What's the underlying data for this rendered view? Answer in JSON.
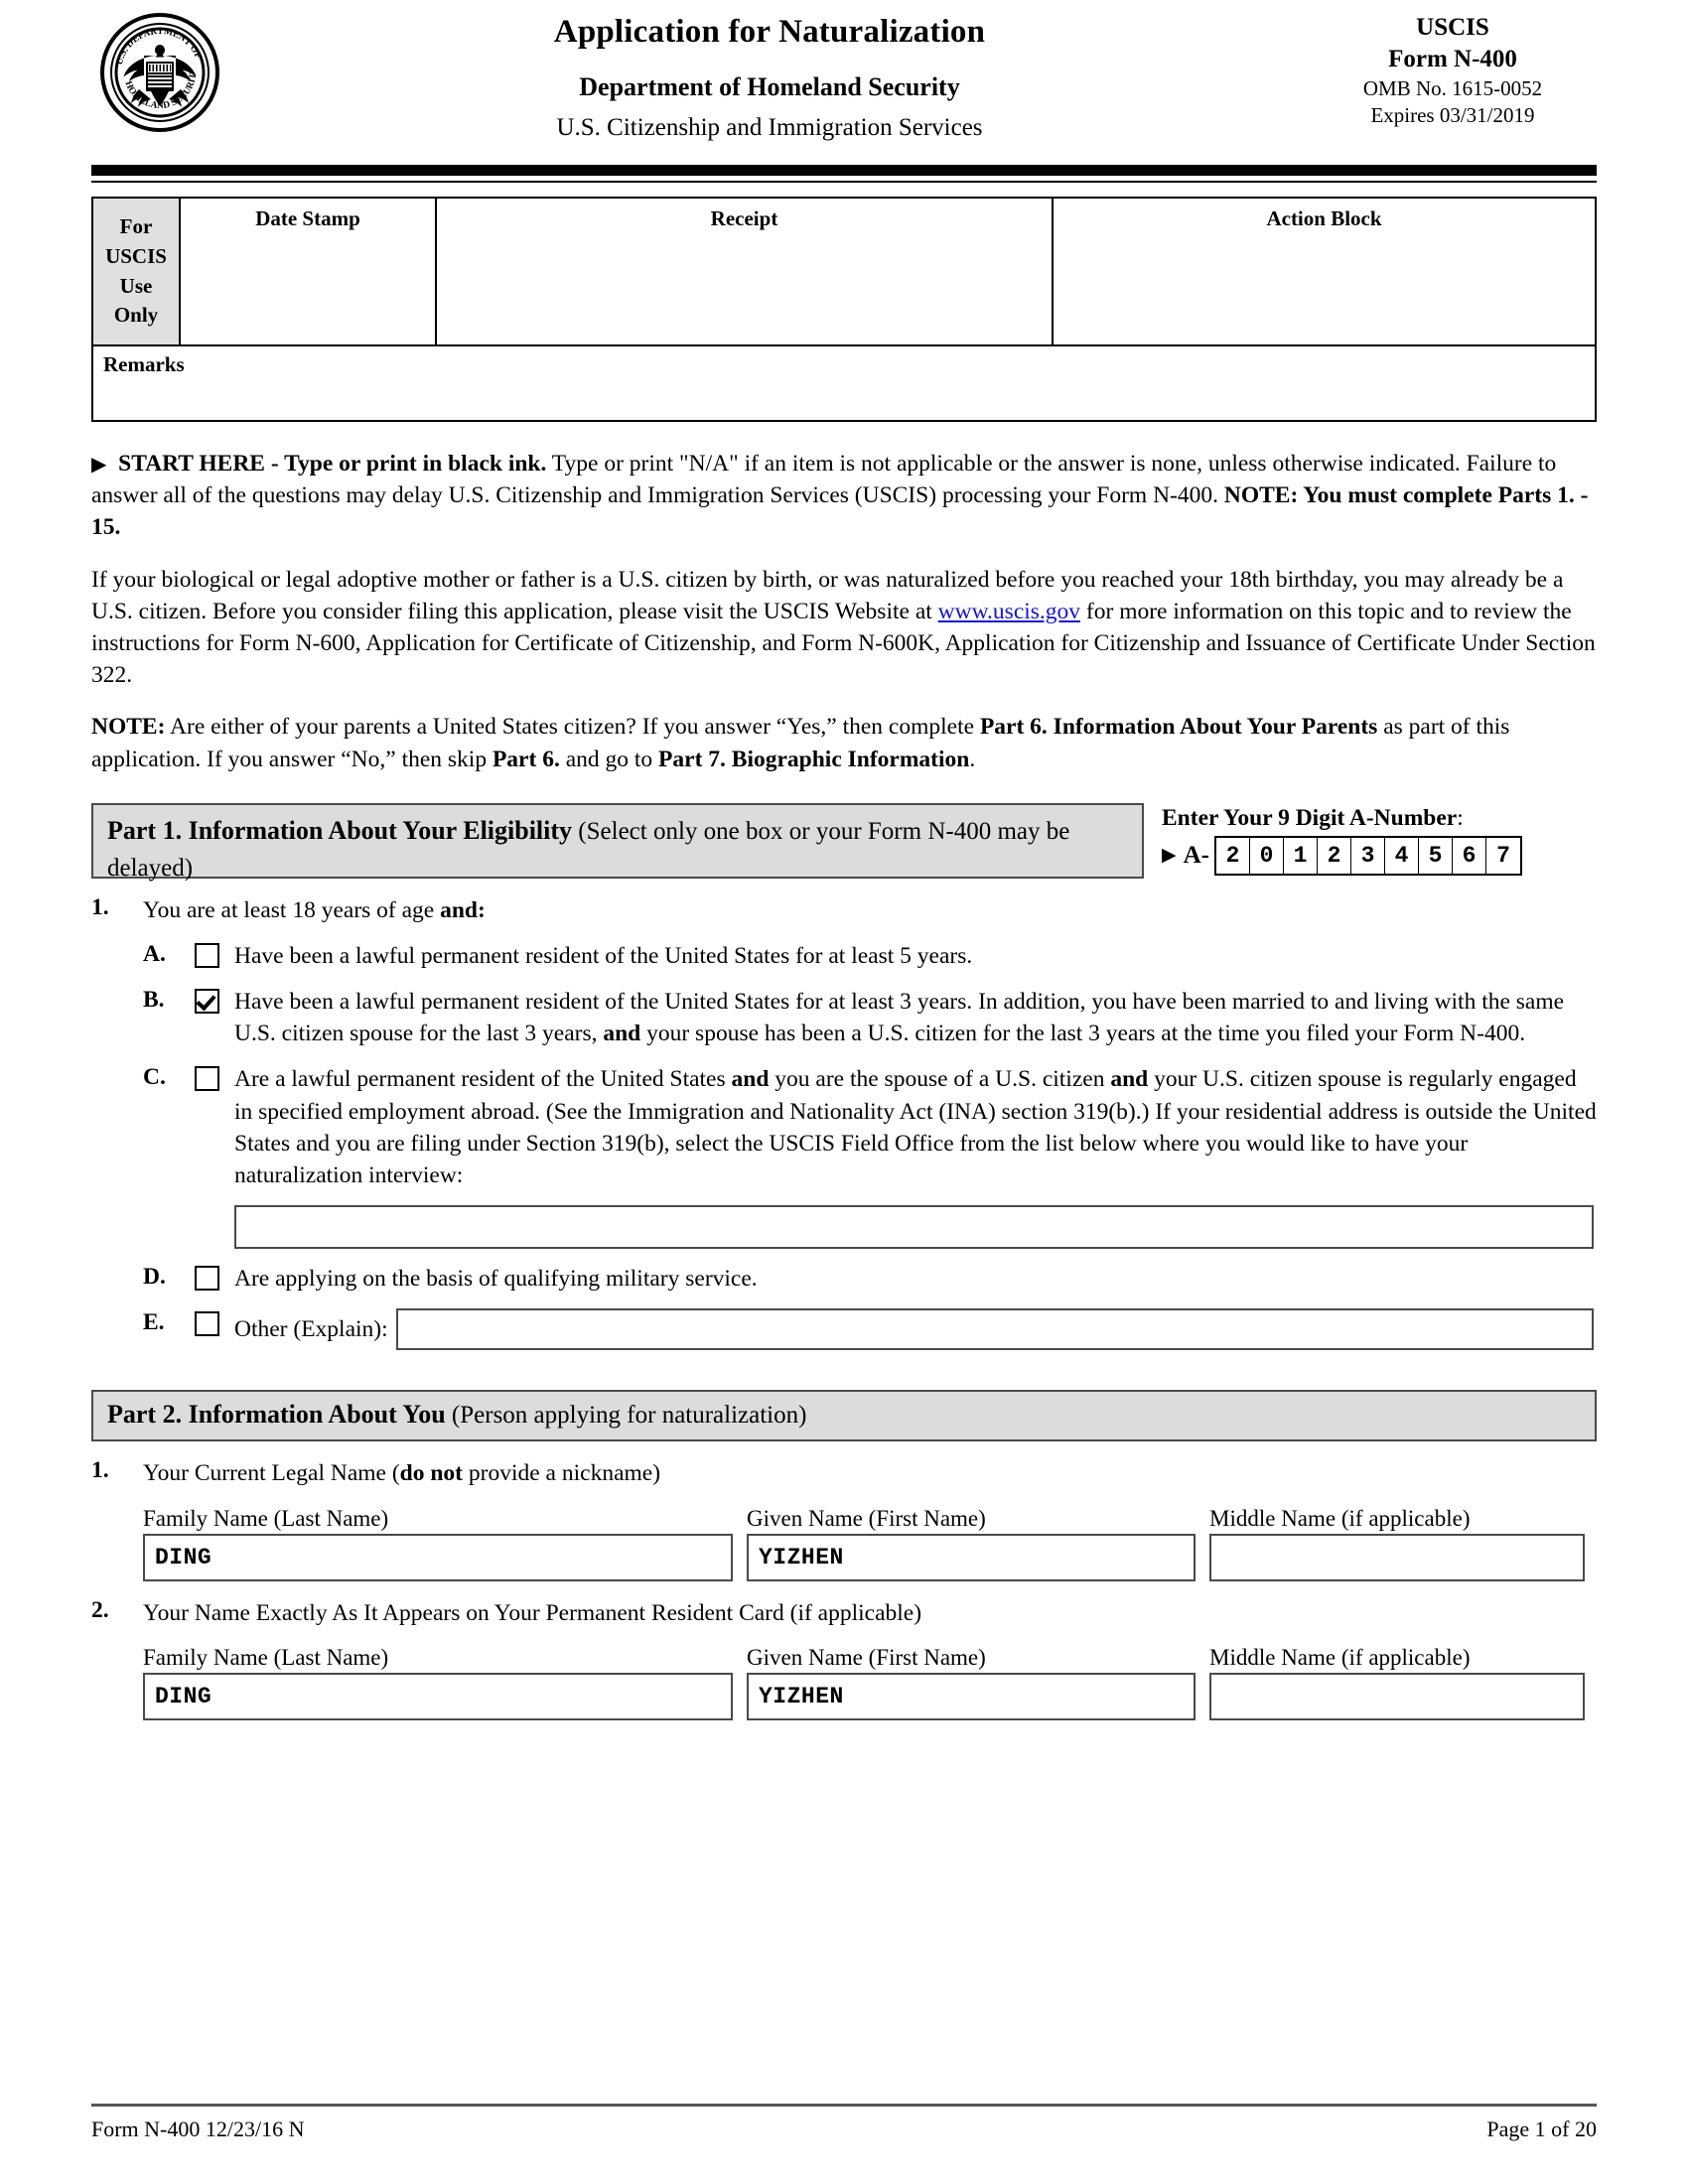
{
  "header": {
    "seal_alt": "dhs-seal",
    "title": "Application for Naturalization",
    "department": "Department of Homeland Security",
    "agency": "U.S. Citizenship and Immigration Services",
    "uscis": "USCIS",
    "form_number": "Form N-400",
    "omb": "OMB No. 1615-0052",
    "expires": "Expires 03/31/2019"
  },
  "uscis_use_only": {
    "label": "For USCIS Use Only",
    "label_lines": [
      "For",
      "USCIS",
      "Use",
      "Only"
    ],
    "columns": [
      "Date Stamp",
      "Receipt",
      "Action Block"
    ],
    "remarks_label": "Remarks",
    "date_stamp_value": "",
    "receipt_value": "",
    "action_block_value": "",
    "remarks_value": ""
  },
  "intro": {
    "arrow": "▶",
    "start_here_bold": "START HERE - Type or print in black ink.",
    "start_here_rest": " Type or print \"N/A\" if an item is not applicable or the answer is none, unless otherwise indicated.  Failure to answer all of the questions may delay U.S. Citizenship and Immigration Services (USCIS) processing your Form N-400.  ",
    "start_here_note": "NOTE:  You must complete Parts 1. - 15.",
    "para2_before_link": "If your biological or legal adoptive mother or father is a U.S. citizen by birth, or was naturalized before you reached your 18th birthday, you may already be a U.S. citizen.  Before you consider filing this application, please visit the USCIS Website at ",
    "para2_link": "www.uscis.gov",
    "para2_after_link": " for more information on this topic and to review the instructions for Form N-600, Application for Certificate of Citizenship, and Form N-600K, Application for Citizenship and Issuance of Certificate Under Section 322.",
    "note_label": "NOTE:",
    "note_text_1": "  Are either of your parents a United States citizen?  If you answer “Yes,” then complete ",
    "note_bold_1": "Part 6.  Information About Your Parents",
    "note_text_2": " as part of this application.  If you answer “No,” then skip ",
    "note_bold_2": "Part 6.",
    "note_text_3": " and go to ",
    "note_bold_3": "Part 7.  Biographic Information",
    "note_text_4": "."
  },
  "part1": {
    "bar_bold": "Part 1.  Information About Your Eligibility",
    "bar_normal": " (Select only one box or your Form N-400 may be delayed)",
    "anumber_label": "Enter Your 9 Digit A-Number",
    "anumber_colon": ":",
    "anumber_arrow": "▶",
    "anumber_prefix": "A-",
    "anumber_digits": [
      "2",
      "0",
      "1",
      "2",
      "3",
      "4",
      "5",
      "6",
      "7"
    ],
    "question_number": "1.",
    "question_text_before": "You are at least 18 years of age ",
    "question_text_bold": "and:",
    "options": [
      {
        "letter": "A.",
        "checked": false,
        "text": "Have been a lawful permanent resident of the United States for at least 5 years."
      },
      {
        "letter": "B.",
        "checked": true,
        "text_1": "Have been a lawful permanent resident of the United States for at least 3 years.  In addition, you have been married to and living with the same U.S. citizen spouse for the last 3 years, ",
        "bold_1": "and",
        "text_2": " your spouse has been a U.S. citizen for the last 3 years at the time you filed your Form N-400."
      },
      {
        "letter": "C.",
        "checked": false,
        "text_1": "Are a lawful permanent resident of the United States ",
        "bold_1": "and",
        "text_2": " you are the spouse of a U.S. citizen ",
        "bold_2": "and",
        "text_3": " your U.S. citizen spouse is regularly engaged in specified employment abroad.  (See the Immigration and Nationality Act (INA) section 319(b).)  If your residential address is outside the United States and you are filing under Section 319(b), select the USCIS Field Office from the list below where you would like to have your naturalization interview:",
        "field_value": ""
      },
      {
        "letter": "D.",
        "checked": false,
        "text": "Are applying on the basis of qualifying military service."
      },
      {
        "letter": "E.",
        "checked": false,
        "text": "Other (Explain):",
        "field_value": ""
      }
    ]
  },
  "part2": {
    "bar_bold": "Part 2.  Information About You",
    "bar_normal": " (Person applying for naturalization)",
    "items": [
      {
        "number": "1.",
        "label_before": "Your Current Legal Name (",
        "label_bold": "do not",
        "label_after": " provide a nickname)",
        "fields": [
          {
            "label": "Family Name (Last Name)",
            "value": "DING"
          },
          {
            "label": "Given Name (First Name)",
            "value": "YIZHEN"
          },
          {
            "label": "Middle Name (if applicable)",
            "value": ""
          }
        ]
      },
      {
        "number": "2.",
        "label_before": "Your Name Exactly As It Appears on Your Permanent Resident Card (if applicable)",
        "label_bold": "",
        "label_after": "",
        "fields": [
          {
            "label": "Family Name (Last Name)",
            "value": "DING"
          },
          {
            "label": "Given Name (First Name)",
            "value": "YIZHEN"
          },
          {
            "label": "Middle Name (if applicable)",
            "value": ""
          }
        ]
      }
    ]
  },
  "footer": {
    "left": "Form N-400   12/23/16   N",
    "right": "Page 1 of 20"
  },
  "colors": {
    "rule": "#000000",
    "part_bar_bg": "#dcdcdc",
    "part_bar_border": "#4a4a4a",
    "use_only_bg": "#e0e0e0",
    "link": "#1414d2"
  }
}
